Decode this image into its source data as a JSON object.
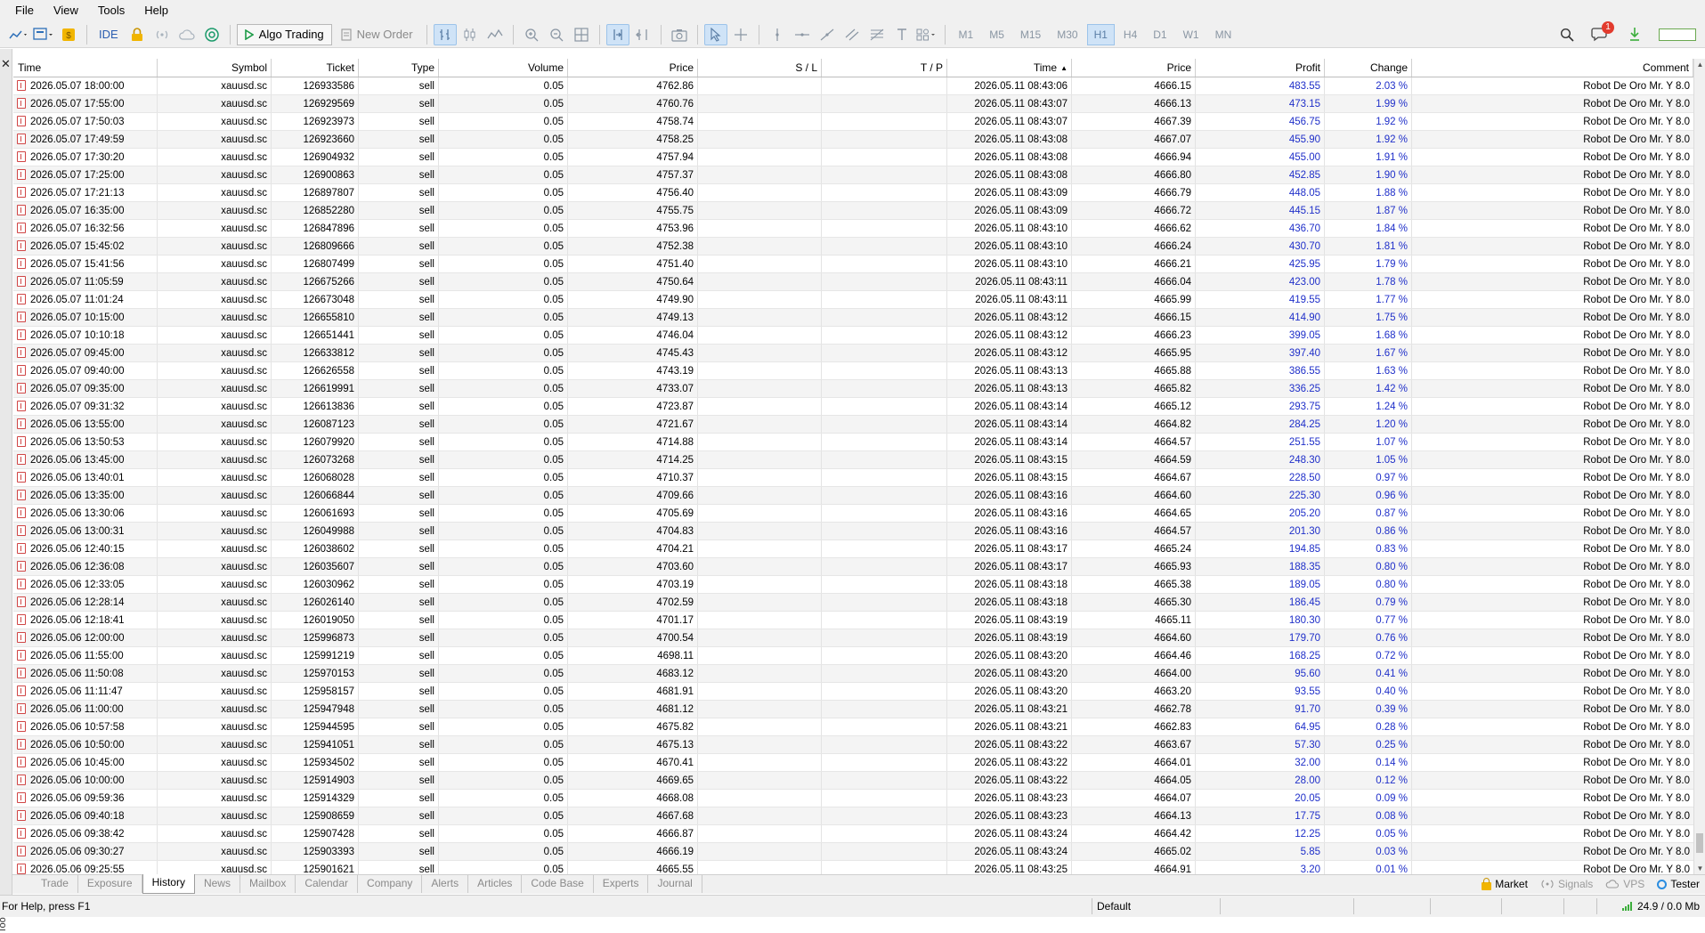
{
  "menu": [
    "File",
    "View",
    "Tools",
    "Help"
  ],
  "toolbar": {
    "ide_label": "IDE",
    "algo_trading_label": "Algo Trading",
    "new_order_label": "New Order",
    "timeframes": [
      "M1",
      "M5",
      "M15",
      "M30",
      "H1",
      "H4",
      "D1",
      "W1",
      "MN"
    ],
    "active_timeframe": "H1",
    "notification_count": "1"
  },
  "table": {
    "columns": [
      "Time",
      "Symbol",
      "Ticket",
      "Type",
      "Volume",
      "Price",
      "S / L",
      "T / P",
      "Time",
      "Price",
      "Profit",
      "Change",
      "Comment"
    ],
    "sorted_column_index": 8,
    "rows": [
      [
        "2026.05.07 18:00:00",
        "xauusd.sc",
        "126933586",
        "sell",
        "0.05",
        "4762.86",
        "",
        "",
        "2026.05.11 08:43:06",
        "4666.15",
        "483.55",
        "2.03 %",
        "Robot De Oro Mr. Y 8.0"
      ],
      [
        "2026.05.07 17:55:00",
        "xauusd.sc",
        "126929569",
        "sell",
        "0.05",
        "4760.76",
        "",
        "",
        "2026.05.11 08:43:07",
        "4666.13",
        "473.15",
        "1.99 %",
        "Robot De Oro Mr. Y 8.0"
      ],
      [
        "2026.05.07 17:50:03",
        "xauusd.sc",
        "126923973",
        "sell",
        "0.05",
        "4758.74",
        "",
        "",
        "2026.05.11 08:43:07",
        "4667.39",
        "456.75",
        "1.92 %",
        "Robot De Oro Mr. Y 8.0"
      ],
      [
        "2026.05.07 17:49:59",
        "xauusd.sc",
        "126923660",
        "sell",
        "0.05",
        "4758.25",
        "",
        "",
        "2026.05.11 08:43:08",
        "4667.07",
        "455.90",
        "1.92 %",
        "Robot De Oro Mr. Y 8.0"
      ],
      [
        "2026.05.07 17:30:20",
        "xauusd.sc",
        "126904932",
        "sell",
        "0.05",
        "4757.94",
        "",
        "",
        "2026.05.11 08:43:08",
        "4666.94",
        "455.00",
        "1.91 %",
        "Robot De Oro Mr. Y 8.0"
      ],
      [
        "2026.05.07 17:25:00",
        "xauusd.sc",
        "126900863",
        "sell",
        "0.05",
        "4757.37",
        "",
        "",
        "2026.05.11 08:43:08",
        "4666.80",
        "452.85",
        "1.90 %",
        "Robot De Oro Mr. Y 8.0"
      ],
      [
        "2026.05.07 17:21:13",
        "xauusd.sc",
        "126897807",
        "sell",
        "0.05",
        "4756.40",
        "",
        "",
        "2026.05.11 08:43:09",
        "4666.79",
        "448.05",
        "1.88 %",
        "Robot De Oro Mr. Y 8.0"
      ],
      [
        "2026.05.07 16:35:00",
        "xauusd.sc",
        "126852280",
        "sell",
        "0.05",
        "4755.75",
        "",
        "",
        "2026.05.11 08:43:09",
        "4666.72",
        "445.15",
        "1.87 %",
        "Robot De Oro Mr. Y 8.0"
      ],
      [
        "2026.05.07 16:32:56",
        "xauusd.sc",
        "126847896",
        "sell",
        "0.05",
        "4753.96",
        "",
        "",
        "2026.05.11 08:43:10",
        "4666.62",
        "436.70",
        "1.84 %",
        "Robot De Oro Mr. Y 8.0"
      ],
      [
        "2026.05.07 15:45:02",
        "xauusd.sc",
        "126809666",
        "sell",
        "0.05",
        "4752.38",
        "",
        "",
        "2026.05.11 08:43:10",
        "4666.24",
        "430.70",
        "1.81 %",
        "Robot De Oro Mr. Y 8.0"
      ],
      [
        "2026.05.07 15:41:56",
        "xauusd.sc",
        "126807499",
        "sell",
        "0.05",
        "4751.40",
        "",
        "",
        "2026.05.11 08:43:10",
        "4666.21",
        "425.95",
        "1.79 %",
        "Robot De Oro Mr. Y 8.0"
      ],
      [
        "2026.05.07 11:05:59",
        "xauusd.sc",
        "126675266",
        "sell",
        "0.05",
        "4750.64",
        "",
        "",
        "2026.05.11 08:43:11",
        "4666.04",
        "423.00",
        "1.78 %",
        "Robot De Oro Mr. Y 8.0"
      ],
      [
        "2026.05.07 11:01:24",
        "xauusd.sc",
        "126673048",
        "sell",
        "0.05",
        "4749.90",
        "",
        "",
        "2026.05.11 08:43:11",
        "4665.99",
        "419.55",
        "1.77 %",
        "Robot De Oro Mr. Y 8.0"
      ],
      [
        "2026.05.07 10:15:00",
        "xauusd.sc",
        "126655810",
        "sell",
        "0.05",
        "4749.13",
        "",
        "",
        "2026.05.11 08:43:12",
        "4666.15",
        "414.90",
        "1.75 %",
        "Robot De Oro Mr. Y 8.0"
      ],
      [
        "2026.05.07 10:10:18",
        "xauusd.sc",
        "126651441",
        "sell",
        "0.05",
        "4746.04",
        "",
        "",
        "2026.05.11 08:43:12",
        "4666.23",
        "399.05",
        "1.68 %",
        "Robot De Oro Mr. Y 8.0"
      ],
      [
        "2026.05.07 09:45:00",
        "xauusd.sc",
        "126633812",
        "sell",
        "0.05",
        "4745.43",
        "",
        "",
        "2026.05.11 08:43:12",
        "4665.95",
        "397.40",
        "1.67 %",
        "Robot De Oro Mr. Y 8.0"
      ],
      [
        "2026.05.07 09:40:00",
        "xauusd.sc",
        "126626558",
        "sell",
        "0.05",
        "4743.19",
        "",
        "",
        "2026.05.11 08:43:13",
        "4665.88",
        "386.55",
        "1.63 %",
        "Robot De Oro Mr. Y 8.0"
      ],
      [
        "2026.05.07 09:35:00",
        "xauusd.sc",
        "126619991",
        "sell",
        "0.05",
        "4733.07",
        "",
        "",
        "2026.05.11 08:43:13",
        "4665.82",
        "336.25",
        "1.42 %",
        "Robot De Oro Mr. Y 8.0"
      ],
      [
        "2026.05.07 09:31:32",
        "xauusd.sc",
        "126613836",
        "sell",
        "0.05",
        "4723.87",
        "",
        "",
        "2026.05.11 08:43:14",
        "4665.12",
        "293.75",
        "1.24 %",
        "Robot De Oro Mr. Y 8.0"
      ],
      [
        "2026.05.06 13:55:00",
        "xauusd.sc",
        "126087123",
        "sell",
        "0.05",
        "4721.67",
        "",
        "",
        "2026.05.11 08:43:14",
        "4664.82",
        "284.25",
        "1.20 %",
        "Robot De Oro Mr. Y 8.0"
      ],
      [
        "2026.05.06 13:50:53",
        "xauusd.sc",
        "126079920",
        "sell",
        "0.05",
        "4714.88",
        "",
        "",
        "2026.05.11 08:43:14",
        "4664.57",
        "251.55",
        "1.07 %",
        "Robot De Oro Mr. Y 8.0"
      ],
      [
        "2026.05.06 13:45:00",
        "xauusd.sc",
        "126073268",
        "sell",
        "0.05",
        "4714.25",
        "",
        "",
        "2026.05.11 08:43:15",
        "4664.59",
        "248.30",
        "1.05 %",
        "Robot De Oro Mr. Y 8.0"
      ],
      [
        "2026.05.06 13:40:01",
        "xauusd.sc",
        "126068028",
        "sell",
        "0.05",
        "4710.37",
        "",
        "",
        "2026.05.11 08:43:15",
        "4664.67",
        "228.50",
        "0.97 %",
        "Robot De Oro Mr. Y 8.0"
      ],
      [
        "2026.05.06 13:35:00",
        "xauusd.sc",
        "126066844",
        "sell",
        "0.05",
        "4709.66",
        "",
        "",
        "2026.05.11 08:43:16",
        "4664.60",
        "225.30",
        "0.96 %",
        "Robot De Oro Mr. Y 8.0"
      ],
      [
        "2026.05.06 13:30:06",
        "xauusd.sc",
        "126061693",
        "sell",
        "0.05",
        "4705.69",
        "",
        "",
        "2026.05.11 08:43:16",
        "4664.65",
        "205.20",
        "0.87 %",
        "Robot De Oro Mr. Y 8.0"
      ],
      [
        "2026.05.06 13:00:31",
        "xauusd.sc",
        "126049988",
        "sell",
        "0.05",
        "4704.83",
        "",
        "",
        "2026.05.11 08:43:16",
        "4664.57",
        "201.30",
        "0.86 %",
        "Robot De Oro Mr. Y 8.0"
      ],
      [
        "2026.05.06 12:40:15",
        "xauusd.sc",
        "126038602",
        "sell",
        "0.05",
        "4704.21",
        "",
        "",
        "2026.05.11 08:43:17",
        "4665.24",
        "194.85",
        "0.83 %",
        "Robot De Oro Mr. Y 8.0"
      ],
      [
        "2026.05.06 12:36:08",
        "xauusd.sc",
        "126035607",
        "sell",
        "0.05",
        "4703.60",
        "",
        "",
        "2026.05.11 08:43:17",
        "4665.93",
        "188.35",
        "0.80 %",
        "Robot De Oro Mr. Y 8.0"
      ],
      [
        "2026.05.06 12:33:05",
        "xauusd.sc",
        "126030962",
        "sell",
        "0.05",
        "4703.19",
        "",
        "",
        "2026.05.11 08:43:18",
        "4665.38",
        "189.05",
        "0.80 %",
        "Robot De Oro Mr. Y 8.0"
      ],
      [
        "2026.05.06 12:28:14",
        "xauusd.sc",
        "126026140",
        "sell",
        "0.05",
        "4702.59",
        "",
        "",
        "2026.05.11 08:43:18",
        "4665.30",
        "186.45",
        "0.79 %",
        "Robot De Oro Mr. Y 8.0"
      ],
      [
        "2026.05.06 12:18:41",
        "xauusd.sc",
        "126019050",
        "sell",
        "0.05",
        "4701.17",
        "",
        "",
        "2026.05.11 08:43:19",
        "4665.11",
        "180.30",
        "0.77 %",
        "Robot De Oro Mr. Y 8.0"
      ],
      [
        "2026.05.06 12:00:00",
        "xauusd.sc",
        "125996873",
        "sell",
        "0.05",
        "4700.54",
        "",
        "",
        "2026.05.11 08:43:19",
        "4664.60",
        "179.70",
        "0.76 %",
        "Robot De Oro Mr. Y 8.0"
      ],
      [
        "2026.05.06 11:55:00",
        "xauusd.sc",
        "125991219",
        "sell",
        "0.05",
        "4698.11",
        "",
        "",
        "2026.05.11 08:43:20",
        "4664.46",
        "168.25",
        "0.72 %",
        "Robot De Oro Mr. Y 8.0"
      ],
      [
        "2026.05.06 11:50:08",
        "xauusd.sc",
        "125970153",
        "sell",
        "0.05",
        "4683.12",
        "",
        "",
        "2026.05.11 08:43:20",
        "4664.00",
        "95.60",
        "0.41 %",
        "Robot De Oro Mr. Y 8.0"
      ],
      [
        "2026.05.06 11:11:47",
        "xauusd.sc",
        "125958157",
        "sell",
        "0.05",
        "4681.91",
        "",
        "",
        "2026.05.11 08:43:20",
        "4663.20",
        "93.55",
        "0.40 %",
        "Robot De Oro Mr. Y 8.0"
      ],
      [
        "2026.05.06 11:00:00",
        "xauusd.sc",
        "125947948",
        "sell",
        "0.05",
        "4681.12",
        "",
        "",
        "2026.05.11 08:43:21",
        "4662.78",
        "91.70",
        "0.39 %",
        "Robot De Oro Mr. Y 8.0"
      ],
      [
        "2026.05.06 10:57:58",
        "xauusd.sc",
        "125944595",
        "sell",
        "0.05",
        "4675.82",
        "",
        "",
        "2026.05.11 08:43:21",
        "4662.83",
        "64.95",
        "0.28 %",
        "Robot De Oro Mr. Y 8.0"
      ],
      [
        "2026.05.06 10:50:00",
        "xauusd.sc",
        "125941051",
        "sell",
        "0.05",
        "4675.13",
        "",
        "",
        "2026.05.11 08:43:22",
        "4663.67",
        "57.30",
        "0.25 %",
        "Robot De Oro Mr. Y 8.0"
      ],
      [
        "2026.05.06 10:45:00",
        "xauusd.sc",
        "125934502",
        "sell",
        "0.05",
        "4670.41",
        "",
        "",
        "2026.05.11 08:43:22",
        "4664.01",
        "32.00",
        "0.14 %",
        "Robot De Oro Mr. Y 8.0"
      ],
      [
        "2026.05.06 10:00:00",
        "xauusd.sc",
        "125914903",
        "sell",
        "0.05",
        "4669.65",
        "",
        "",
        "2026.05.11 08:43:22",
        "4664.05",
        "28.00",
        "0.12 %",
        "Robot De Oro Mr. Y 8.0"
      ],
      [
        "2026.05.06 09:59:36",
        "xauusd.sc",
        "125914329",
        "sell",
        "0.05",
        "4668.08",
        "",
        "",
        "2026.05.11 08:43:23",
        "4664.07",
        "20.05",
        "0.09 %",
        "Robot De Oro Mr. Y 8.0"
      ],
      [
        "2026.05.06 09:40:18",
        "xauusd.sc",
        "125908659",
        "sell",
        "0.05",
        "4667.68",
        "",
        "",
        "2026.05.11 08:43:23",
        "4664.13",
        "17.75",
        "0.08 %",
        "Robot De Oro Mr. Y 8.0"
      ],
      [
        "2026.05.06 09:38:42",
        "xauusd.sc",
        "125907428",
        "sell",
        "0.05",
        "4666.87",
        "",
        "",
        "2026.05.11 08:43:24",
        "4664.42",
        "12.25",
        "0.05 %",
        "Robot De Oro Mr. Y 8.0"
      ],
      [
        "2026.05.06 09:30:27",
        "xauusd.sc",
        "125903393",
        "sell",
        "0.05",
        "4666.19",
        "",
        "",
        "2026.05.11 08:43:24",
        "4665.02",
        "5.85",
        "0.03 %",
        "Robot De Oro Mr. Y 8.0"
      ],
      [
        "2026.05.06 09:25:55",
        "xauusd.sc",
        "125901621",
        "sell",
        "0.05",
        "4665.55",
        "",
        "",
        "2026.05.11 08:43:25",
        "4664.91",
        "3.20",
        "0.01 %",
        "Robot De Oro Mr. Y 8.0"
      ]
    ]
  },
  "toolbox_label": "Toolbox",
  "tabs": [
    "Trade",
    "Exposure",
    "History",
    "News",
    "Mailbox",
    "Calendar",
    "Company",
    "Alerts",
    "Articles",
    "Code Base",
    "Experts",
    "Journal"
  ],
  "active_tab": "History",
  "tabs_right": {
    "market": "Market",
    "signals": "Signals",
    "vps": "VPS",
    "tester": "Tester"
  },
  "status": {
    "help": "For Help, press F1",
    "profile": "Default",
    "traffic": "24.9 / 0.0 Mb"
  },
  "colors": {
    "profit_text": "#1f2fc9",
    "row_icon": "#d04545",
    "notification_badge": "#e23b2e"
  }
}
